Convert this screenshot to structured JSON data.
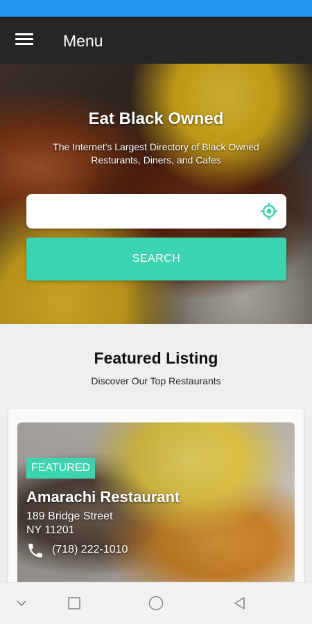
{
  "app_bar": {
    "title": "Menu"
  },
  "hero": {
    "title": "Eat Black Owned",
    "subtitle": "The Internet's Largest Directory of Black Owned Resturants, Diners, and Cafes",
    "search_value": "",
    "search_button_label": "SEARCH",
    "locate_icon": "gps-crosshair-icon"
  },
  "featured_section": {
    "title": "Featured Listing",
    "subtitle": "Discover Our Top Restaurants"
  },
  "listing": {
    "badge": "FEATURED",
    "name": "Amarachi Restaurant",
    "street": "189 Bridge Street",
    "city": "NY 11201",
    "phone": "(718) 222-1010",
    "phone_icon": "phone-icon"
  },
  "colors": {
    "status_bar": "#2196f3",
    "app_bar": "#262626",
    "accent": "#3bd3b0"
  },
  "nav_icons": [
    "chevron-down-icon",
    "recents-square-icon",
    "home-circle-icon",
    "back-triangle-icon"
  ]
}
